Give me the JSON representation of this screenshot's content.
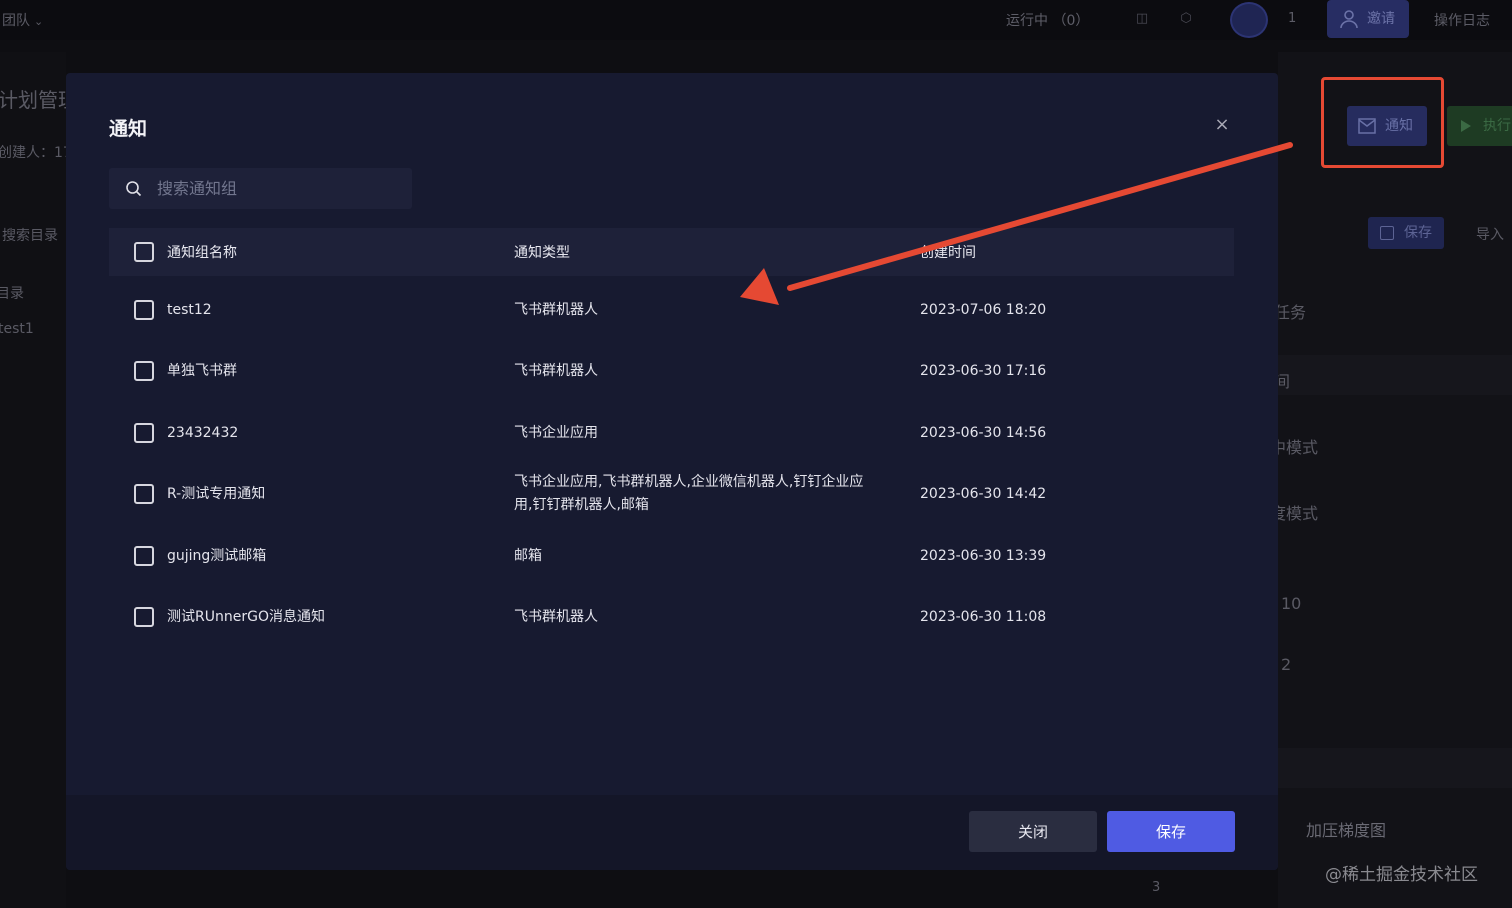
{
  "topbar": {
    "team_label": "团队",
    "running_label": "运行中 （0）",
    "avatar_count": "1",
    "invite_label": "邀请",
    "oplog_label": "操作日志"
  },
  "background": {
    "page_title_partial": "计划管理",
    "creator_partial": "创建人：17",
    "search_dir_partial": "搜索目录",
    "dir_partial": "目录",
    "item_partial": "test1",
    "notice_button": "通知",
    "exec_button": "执行",
    "save_button": "保存",
    "import_button": "导入",
    "right_labels": [
      "任务",
      "间",
      "中模式",
      "度模式",
      "10",
      "2"
    ],
    "chart_label": "加压梯度图",
    "page_number": "3"
  },
  "modal": {
    "title": "通知",
    "search_placeholder": "搜索通知组",
    "columns": {
      "name": "通知组名称",
      "type": "通知类型",
      "created": "创建时间"
    },
    "rows": [
      {
        "name": "test12",
        "type": "飞书群机器人",
        "created": "2023-07-06 18:20"
      },
      {
        "name": "单独飞书群",
        "type": "飞书群机器人",
        "created": "2023-06-30 17:16"
      },
      {
        "name": "23432432",
        "type": "飞书企业应用",
        "created": "2023-06-30 14:56"
      },
      {
        "name": "R-测试专用通知",
        "type_line1": "飞书企业应用,飞书群机器人,企业微信机器人,钉钉企业应",
        "type_line2": "用,钉钉群机器人,邮箱",
        "created": "2023-06-30 14:42"
      },
      {
        "name": "gujing测试邮箱",
        "type": "邮箱",
        "created": "2023-06-30 13:39"
      },
      {
        "name": "测试RUnnerGO消息通知",
        "type": "飞书群机器人",
        "created": "2023-06-30 11:08"
      }
    ],
    "close_button": "关闭",
    "save_button": "保存"
  },
  "watermark": "@稀土掘金技术社区",
  "colors": {
    "modal_bg": "#171a30",
    "primary": "#4f5be3",
    "annotation_red": "#e54933"
  }
}
